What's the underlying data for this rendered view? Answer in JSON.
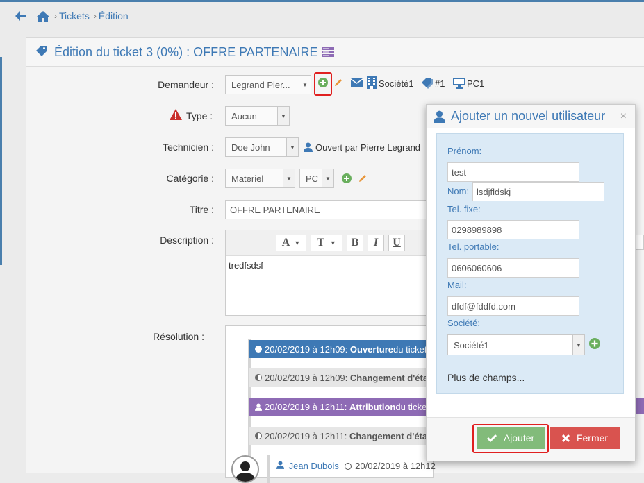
{
  "breadcrumb": {
    "items": [
      "Tickets",
      "Édition"
    ]
  },
  "panel": {
    "title": "Édition du ticket 3 (0%) : OFFRE PARTENAIRE"
  },
  "form": {
    "demandeur_label": "Demandeur :",
    "demandeur_value": "Legrand Pier...",
    "company_link": "Société1",
    "ticket_count": "#1",
    "computer_link": "PC1",
    "type_label": "Type :",
    "type_value": "Aucun",
    "technicien_label": "Technicien :",
    "technicien_value": "Doe John",
    "opened_by": "Ouvert par Pierre Legrand",
    "categorie_label": "Catégorie :",
    "categorie_value": "Materiel",
    "subcategorie_value": "PC",
    "titre_label": "Titre :",
    "titre_value": "OFFRE PARTENAIRE",
    "description_label": "Description :",
    "description_text": "tredfsdsf",
    "resolution_label": "Résolution :"
  },
  "editor_toolbar": [
    "A",
    "T",
    "B",
    "I",
    "U"
  ],
  "timeline": [
    {
      "date": "20/02/2019 à 12h09:",
      "event": "Ouverture",
      "rest": " du ticket",
      "color": "#3e79b5",
      "text_color": "#ffffff"
    },
    {
      "date": "20/02/2019 à 12h09:",
      "event": "Changement d'état",
      "rest": "",
      "color": "#e6e6e6",
      "text_color": "#555555"
    },
    {
      "date": "20/02/2019 à 12h11:",
      "event": "Attribution",
      "rest": " du ticket",
      "color": "#8e6bb5",
      "text_color": "#ffffff"
    },
    {
      "date": "20/02/2019 à 12h11:",
      "event": "Changement d'état",
      "rest": "",
      "color": "#e6e6e6",
      "text_color": "#555555"
    }
  ],
  "comment": {
    "author": "Jean Dubois",
    "date": "20/02/2019 à 12h12"
  },
  "modal": {
    "title": "Ajouter un nouvel utilisateur",
    "close": "×",
    "prenom_label": "Prénom:",
    "prenom_value": "test",
    "nom_label": "Nom:",
    "nom_value": "lsdjfldskj",
    "tel_fixe_label": "Tel. fixe:",
    "tel_fixe_value": "0298989898",
    "tel_portable_label": "Tel. portable:",
    "tel_portable_value": "0606060606",
    "mail_label": "Mail:",
    "mail_value": "dfdf@fddfd.com",
    "societe_label": "Société:",
    "societe_value": "Société1",
    "more_fields": "Plus de champs...",
    "add_button": "Ajouter",
    "close_button": "Fermer"
  },
  "colors": {
    "accent": "#3e79b5",
    "add_green": "#6aaf5e",
    "close_red": "#d9534f",
    "highlight": "#e02020"
  }
}
